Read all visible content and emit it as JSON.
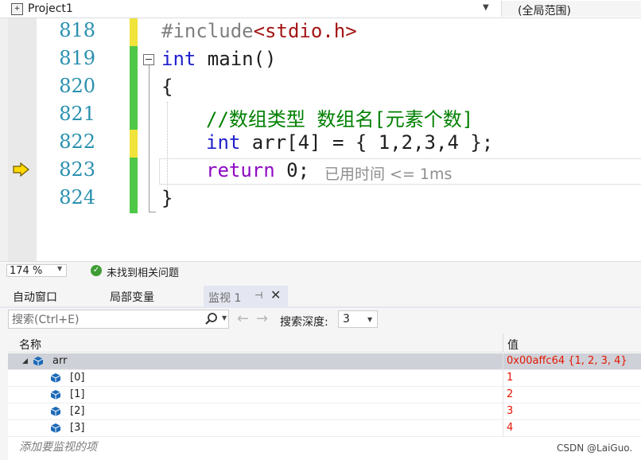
{
  "navbar": {
    "project_icon_text": "+",
    "project_name": "Project1",
    "scope": "(全局范围)"
  },
  "editor": {
    "lines": [
      {
        "number": "818",
        "change": "yellow"
      },
      {
        "number": "819",
        "change": "green"
      },
      {
        "number": "820",
        "change": "green"
      },
      {
        "number": "821",
        "change": "green"
      },
      {
        "number": "822",
        "change": "yellow"
      },
      {
        "number": "823",
        "change": "green"
      },
      {
        "number": "824",
        "change": "green"
      }
    ],
    "code": {
      "l818_pp": "#include",
      "l818_str": "<stdio.h>",
      "l819_kw": "int",
      "l819_rest": " main()",
      "l820": "{",
      "l821_comment": "//数组类型 数组名[元素个数]",
      "l822_kw": "int",
      "l822_rest": " arr[4] = { 1,2,3,4 };",
      "l823_kw": "return",
      "l823_rest": " 0;",
      "l824": "}"
    },
    "timing": "已用时间 <= 1ms",
    "current_line_icon": "arrow-right-yellow"
  },
  "status": {
    "zoom": "174 %",
    "issues": "未找到相关问题",
    "ok_glyph": "✓"
  },
  "tabs": {
    "autos": "自动窗口",
    "locals": "局部变量",
    "watch": "监视 1",
    "pin_glyph": "⊣",
    "close_glyph": "✕"
  },
  "toolbar": {
    "search_placeholder": "搜索(Ctrl+E)",
    "depth_label": "搜索深度:",
    "depth_value": "3",
    "back_glyph": "←",
    "fwd_glyph": "→"
  },
  "watch": {
    "col_name": "名称",
    "col_value": "值",
    "rows": [
      {
        "name": "arr",
        "value": "0x00affc64 {1, 2, 3, 4}"
      },
      {
        "name": "[0]",
        "value": "1"
      },
      {
        "name": "[1]",
        "value": "2"
      },
      {
        "name": "[2]",
        "value": "3"
      },
      {
        "name": "[3]",
        "value": "4"
      }
    ],
    "add_item": "添加要监视的项"
  },
  "watermark": "CSDN @LaiGuo.",
  "colors": {
    "change_green": "#4fc847",
    "change_yellow": "#f0e33b",
    "keyword": "#1f1fcd",
    "comment": "#008000",
    "value_red": "#e51400"
  }
}
